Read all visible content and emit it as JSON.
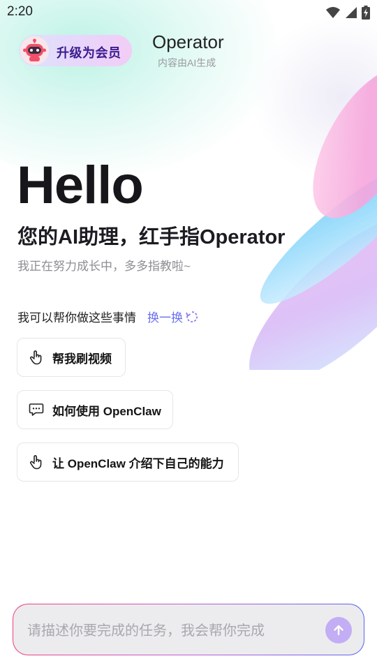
{
  "status_bar": {
    "time": "2:20",
    "icons": [
      "wifi-icon",
      "cellular-signal-icon",
      "battery-charging-icon"
    ]
  },
  "header": {
    "vip_label": "升级为会员",
    "vip_icon": "robot-mascot-icon",
    "title": "Operator",
    "subtitle": "内容由AI生成"
  },
  "hero": {
    "greeting": "Hello",
    "tagline": "您的AI助理，红手指Operator",
    "subtext": "我正在努力成长中，多多指教啦~"
  },
  "suggestions": {
    "title": "我可以帮你做这些事情",
    "refresh_label": "换一换",
    "refresh_icon": "refresh-icon",
    "items": [
      {
        "label": "帮我刷视频",
        "icon": "tap-hand-icon"
      },
      {
        "label": "如何使用 OpenClaw",
        "icon": "chat-bubble-icon"
      },
      {
        "label": "让 OpenClaw 介绍下自己的能力",
        "icon": "tap-hand-icon"
      }
    ]
  },
  "composer": {
    "placeholder": "请描述你要完成的任务，我会帮你完成",
    "value": "",
    "send_icon": "arrow-up-icon"
  },
  "colors": {
    "accent": "#6a6ff0",
    "send_button": "#c3adf4",
    "vip_text": "#3b1b8f",
    "border_gradient_start": "#ee3f7f",
    "border_gradient_end": "#5a63ee"
  }
}
